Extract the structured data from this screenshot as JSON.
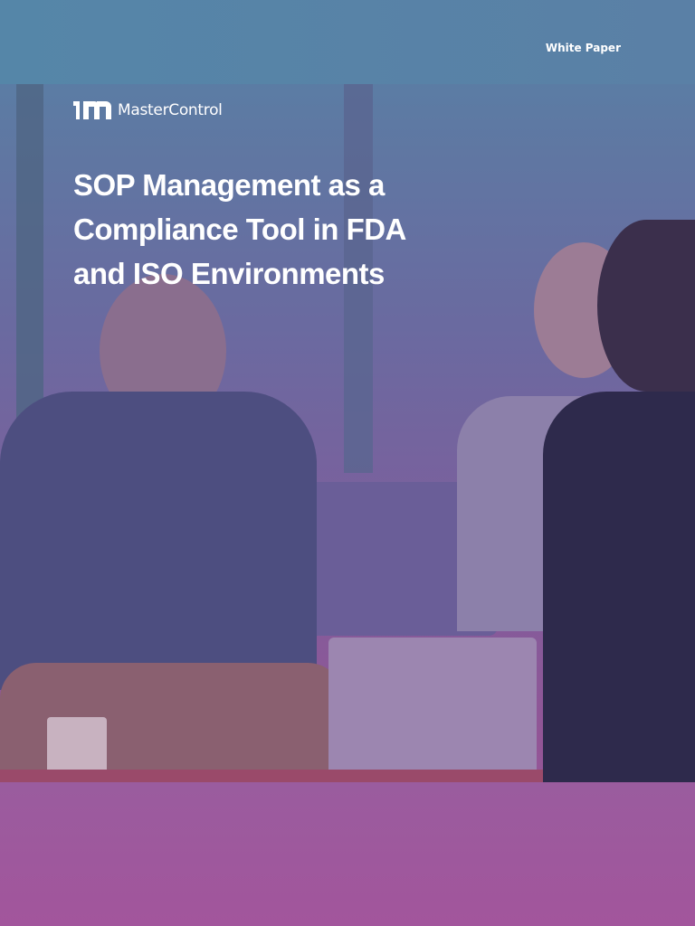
{
  "header": {
    "label": "White Paper"
  },
  "brand": {
    "name": "MasterControl"
  },
  "title": {
    "lines": [
      "SOP Management as a",
      "Compliance Tool in FDA",
      "and ISO Environments"
    ]
  },
  "colors": {
    "top": "#5585a8",
    "bottom": "#a0559c",
    "text": "#ffffff"
  }
}
